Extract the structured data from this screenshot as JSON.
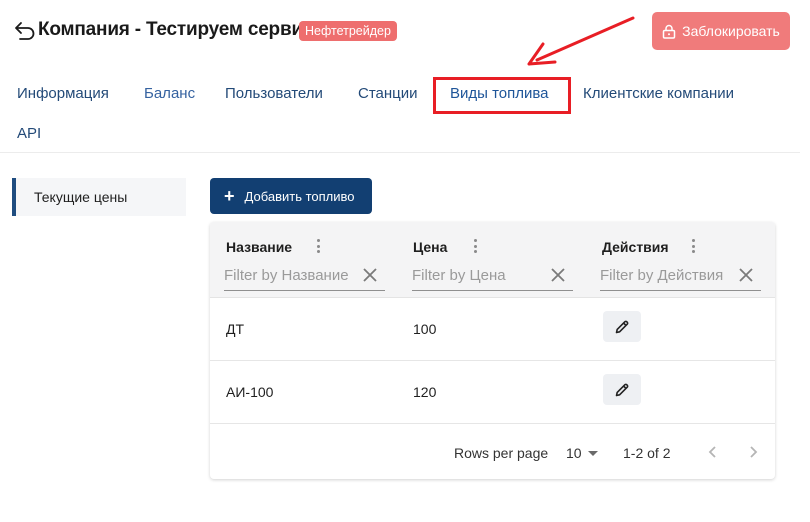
{
  "header": {
    "title": "Компания - Тестируем сервис",
    "badge": "Нефтетрейдер",
    "lock_label": "Заблокировать"
  },
  "tabs": [
    {
      "label": "Информация"
    },
    {
      "label": "Баланс"
    },
    {
      "label": "Пользователи"
    },
    {
      "label": "Станции"
    },
    {
      "label": "Виды топлива",
      "active": true
    },
    {
      "label": "Клиентские компании"
    },
    {
      "label": "API"
    }
  ],
  "sidebar": {
    "items": [
      {
        "label": "Текущие цены"
      }
    ]
  },
  "toolbar": {
    "add_label": "Добавить топливо"
  },
  "grid": {
    "columns": [
      {
        "title": "Название",
        "filter_placeholder": "Filter by Название"
      },
      {
        "title": "Цена",
        "filter_placeholder": "Filter by Цена"
      },
      {
        "title": "Действия",
        "filter_placeholder": "Filter by Действия"
      }
    ],
    "rows": [
      {
        "name": "ДТ",
        "price": "100"
      },
      {
        "name": "АИ-100",
        "price": "120"
      }
    ],
    "footer": {
      "rows_per_page_label": "Rows per page",
      "rows_per_page_value": "10",
      "range": "1-2 of 2"
    }
  },
  "colors": {
    "accent": "#123f72",
    "badge": "#ee6e6e",
    "lock_button": "#f07b7b",
    "tab_text": "#234a78",
    "annotation": "#e81e25"
  },
  "icons": {
    "back": "back-arrow-icon",
    "lock": "lock-icon",
    "add": "plus-icon",
    "column_menu": "vertical-dots-icon",
    "clear": "close-icon",
    "edit": "pencil-icon",
    "prev": "chevron-left-icon",
    "next": "chevron-right-icon"
  }
}
